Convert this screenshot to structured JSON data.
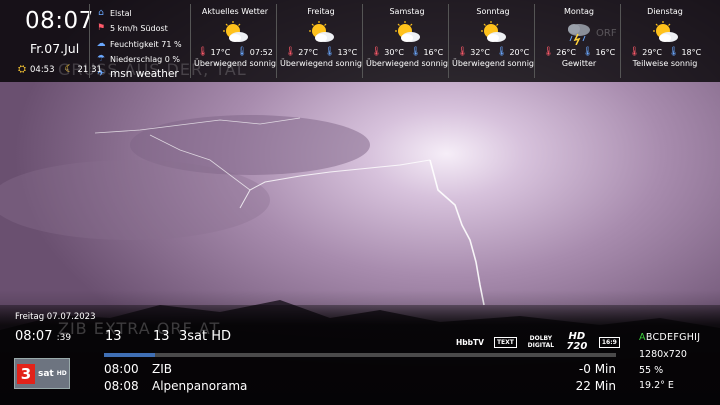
{
  "clock": {
    "time": "08:07",
    "date": "Fr.07.Jul",
    "sunrise": "04:53",
    "sunset": "21:31"
  },
  "location": {
    "place": "Elstal",
    "wind": "5 km/h Südost",
    "humidity": "Feuchtigkeit 71 %",
    "precipitation": "Niederschlag 0 %",
    "source": "msn weather"
  },
  "forecast": [
    {
      "day": "Aktuelles Wetter",
      "icon": "partly-sunny-icon",
      "t1": "17°C",
      "t2": "07:52",
      "desc": "Überwiegend sonnig"
    },
    {
      "day": "Freitag",
      "icon": "partly-sunny-icon",
      "t1": "27°C",
      "t2": "13°C",
      "desc": "Überwiegend sonnig"
    },
    {
      "day": "Samstag",
      "icon": "partly-sunny-icon",
      "t1": "30°C",
      "t2": "16°C",
      "desc": "Überwiegend sonnig"
    },
    {
      "day": "Sonntag",
      "icon": "partly-sunny-icon",
      "t1": "32°C",
      "t2": "20°C",
      "desc": "Überwiegend sonnig"
    },
    {
      "day": "Montag",
      "icon": "thunderstorm-icon",
      "t1": "26°C",
      "t2": "16°C",
      "desc": "Gewitter"
    },
    {
      "day": "Dienstag",
      "icon": "partly-sunny-icon",
      "t1": "29°C",
      "t2": "18°C",
      "desc": "Teilweise sonnig"
    }
  ],
  "ghost_text": {
    "top": "GRUSS AUS DER, TAL",
    "mid": "ZIB  EXTRA ORF AT",
    "orf": "ORF"
  },
  "infobar": {
    "date": "Freitag 07.07.2023",
    "time": "08:07",
    "seconds": "39",
    "channel_number": "13",
    "channel_number2": "13",
    "channel_name": "3sat HD",
    "badges": [
      "HbbTV",
      "TEXT",
      "DOLBY DIGITAL",
      "HD 720",
      "16:9"
    ],
    "progress": 0.1,
    "logo": {
      "number": "3",
      "word": "sat",
      "hd": "HD"
    },
    "events": [
      {
        "time": "08:00",
        "title": "ZIB",
        "remaining": "-0 Min"
      },
      {
        "time": "08:08",
        "title": "Alpenpanorama",
        "remaining": "22 Min"
      }
    ],
    "tech": {
      "alpha_first": "A",
      "alpha_rest": "BCDEFGHIJ",
      "resolution": "1280x720",
      "signal": "55 %",
      "position": "19.2° E"
    }
  },
  "colors": {
    "accent_blue": "#3f6fb4",
    "alpha_green": "#3cd23c",
    "logo_red": "#e2231a"
  }
}
